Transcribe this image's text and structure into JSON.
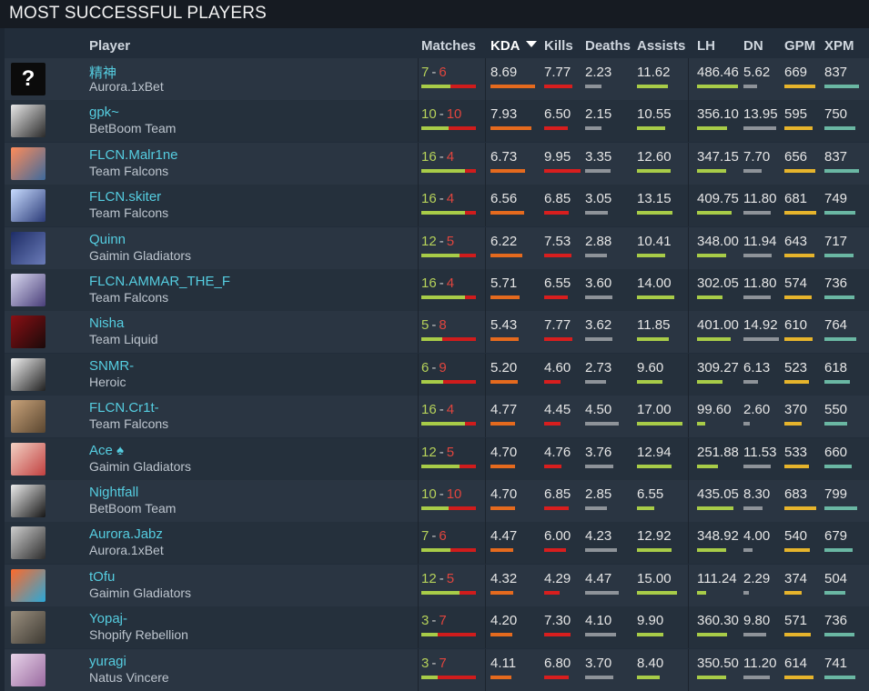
{
  "page": {
    "title": "MOST SUCCESSFUL PLAYERS"
  },
  "header": {
    "player": "Player",
    "matches": "Matches",
    "kda": "KDA",
    "kills": "Kills",
    "deaths": "Deaths",
    "assists": "Assists",
    "lh": "LH",
    "dn": "DN",
    "gpm": "GPM",
    "xpm": "XPM",
    "sorted_by": "KDA",
    "sort_direction": "descending"
  },
  "colors": {
    "wins": "#b5d15a",
    "losses": "#e0453e",
    "kda_bar": "#e56a1e",
    "kills_bar": "#d81e1e",
    "deaths_bar": "#8e9399",
    "assists_bar": "#a8cc48",
    "lh_bar": "#a8cc48",
    "dn_bar": "#8e9399",
    "gpm_bar": "#e6b42c",
    "xpm_bar": "#6ab7a3",
    "player_name": "#55cde0"
  },
  "players": [
    {
      "name": "精神",
      "team": "Aurora.1xBet",
      "avatar": "unknown-avatar-icon",
      "wins": "7",
      "losses": "6",
      "kda": "8.69",
      "kills": "7.77",
      "deaths": "2.23",
      "assists": "11.62",
      "lh": "486.46",
      "dn": "5.62",
      "gpm": "669",
      "xpm": "837"
    },
    {
      "name": "gpk~",
      "team": "BetBoom Team",
      "avatar": "player-avatar",
      "wins": "10",
      "losses": "10",
      "kda": "7.93",
      "kills": "6.50",
      "deaths": "2.15",
      "assists": "10.55",
      "lh": "356.10",
      "dn": "13.95",
      "gpm": "595",
      "xpm": "750"
    },
    {
      "name": "FLCN.Malr1ne",
      "team": "Team Falcons",
      "avatar": "player-avatar",
      "wins": "16",
      "losses": "4",
      "kda": "6.73",
      "kills": "9.95",
      "deaths": "3.35",
      "assists": "12.60",
      "lh": "347.15",
      "dn": "7.70",
      "gpm": "656",
      "xpm": "837"
    },
    {
      "name": "FLCN.skiter",
      "team": "Team Falcons",
      "avatar": "player-avatar",
      "wins": "16",
      "losses": "4",
      "kda": "6.56",
      "kills": "6.85",
      "deaths": "3.05",
      "assists": "13.15",
      "lh": "409.75",
      "dn": "11.80",
      "gpm": "681",
      "xpm": "749"
    },
    {
      "name": "Quinn",
      "team": "Gaimin Gladiators",
      "avatar": "player-avatar",
      "wins": "12",
      "losses": "5",
      "kda": "6.22",
      "kills": "7.53",
      "deaths": "2.88",
      "assists": "10.41",
      "lh": "348.00",
      "dn": "11.94",
      "gpm": "643",
      "xpm": "717"
    },
    {
      "name": "FLCN.AMMAR_THE_F",
      "team": "Team Falcons",
      "avatar": "player-avatar",
      "wins": "16",
      "losses": "4",
      "kda": "5.71",
      "kills": "6.55",
      "deaths": "3.60",
      "assists": "14.00",
      "lh": "302.05",
      "dn": "11.80",
      "gpm": "574",
      "xpm": "736"
    },
    {
      "name": "Nisha",
      "team": "Team Liquid",
      "avatar": "player-avatar",
      "wins": "5",
      "losses": "8",
      "kda": "5.43",
      "kills": "7.77",
      "deaths": "3.62",
      "assists": "11.85",
      "lh": "401.00",
      "dn": "14.92",
      "gpm": "610",
      "xpm": "764"
    },
    {
      "name": "SNMR-",
      "team": "Heroic",
      "avatar": "player-avatar",
      "wins": "6",
      "losses": "9",
      "kda": "5.20",
      "kills": "4.60",
      "deaths": "2.73",
      "assists": "9.60",
      "lh": "309.27",
      "dn": "6.13",
      "gpm": "523",
      "xpm": "618"
    },
    {
      "name": "FLCN.Cr1t-",
      "team": "Team Falcons",
      "avatar": "player-avatar",
      "wins": "16",
      "losses": "4",
      "kda": "4.77",
      "kills": "4.45",
      "deaths": "4.50",
      "assists": "17.00",
      "lh": "99.60",
      "dn": "2.60",
      "gpm": "370",
      "xpm": "550"
    },
    {
      "name": "Ace ♠",
      "team": "Gaimin Gladiators",
      "avatar": "player-avatar",
      "wins": "12",
      "losses": "5",
      "kda": "4.70",
      "kills": "4.76",
      "deaths": "3.76",
      "assists": "12.94",
      "lh": "251.88",
      "dn": "11.53",
      "gpm": "533",
      "xpm": "660"
    },
    {
      "name": "Nightfall",
      "team": "BetBoom Team",
      "avatar": "player-avatar",
      "wins": "10",
      "losses": "10",
      "kda": "4.70",
      "kills": "6.85",
      "deaths": "2.85",
      "assists": "6.55",
      "lh": "435.05",
      "dn": "8.30",
      "gpm": "683",
      "xpm": "799"
    },
    {
      "name": "Aurora.Jabz",
      "team": "Aurora.1xBet",
      "avatar": "player-avatar",
      "wins": "7",
      "losses": "6",
      "kda": "4.47",
      "kills": "6.00",
      "deaths": "4.23",
      "assists": "12.92",
      "lh": "348.92",
      "dn": "4.00",
      "gpm": "540",
      "xpm": "679"
    },
    {
      "name": "tOfu",
      "team": "Gaimin Gladiators",
      "avatar": "player-avatar",
      "wins": "12",
      "losses": "5",
      "kda": "4.32",
      "kills": "4.29",
      "deaths": "4.47",
      "assists": "15.00",
      "lh": "111.24",
      "dn": "2.29",
      "gpm": "374",
      "xpm": "504"
    },
    {
      "name": "Yopaj-",
      "team": "Shopify Rebellion",
      "avatar": "player-avatar",
      "wins": "3",
      "losses": "7",
      "kda": "4.20",
      "kills": "7.30",
      "deaths": "4.10",
      "assists": "9.90",
      "lh": "360.30",
      "dn": "9.80",
      "gpm": "571",
      "xpm": "736"
    },
    {
      "name": "yuragi",
      "team": "Natus Vincere",
      "avatar": "player-avatar",
      "wins": "3",
      "losses": "7",
      "kda": "4.11",
      "kills": "6.80",
      "deaths": "3.70",
      "assists": "8.40",
      "lh": "350.50",
      "dn": "11.20",
      "gpm": "614",
      "xpm": "741"
    }
  ]
}
